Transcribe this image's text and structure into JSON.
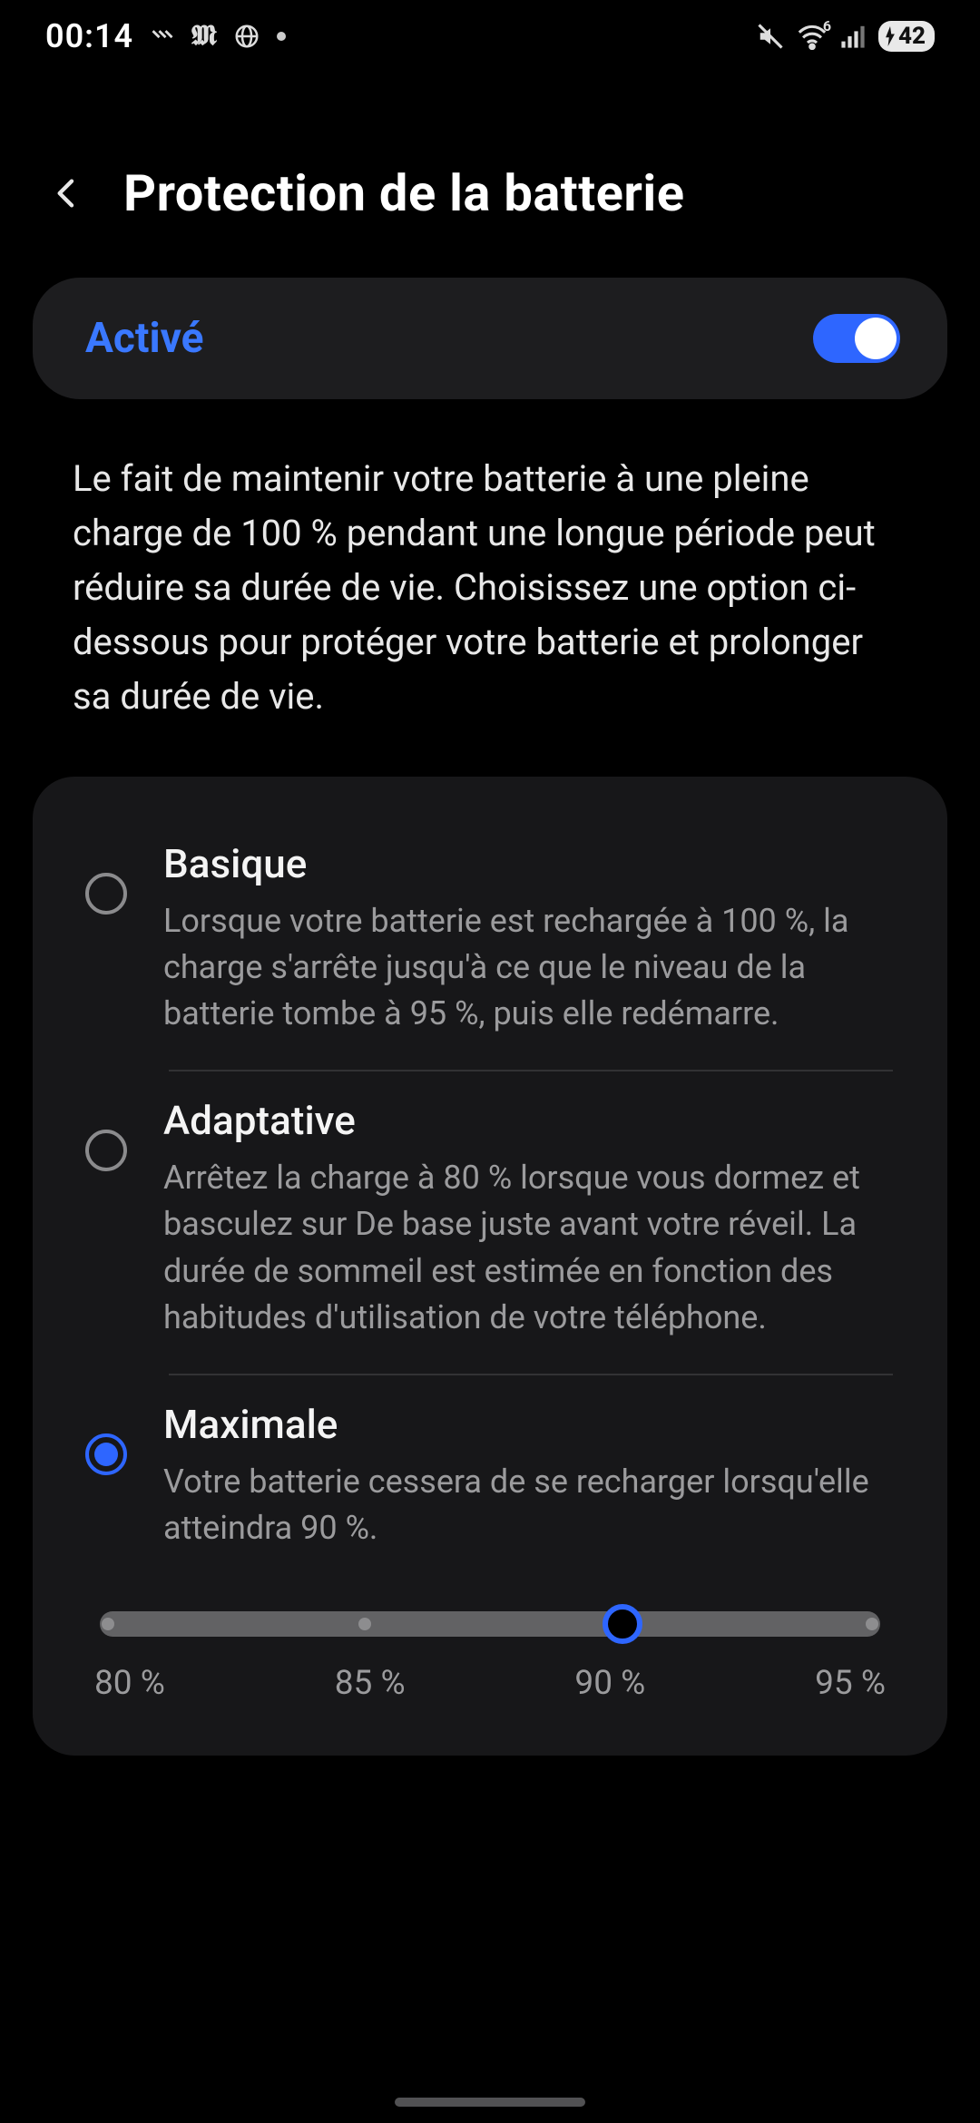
{
  "status": {
    "clock": "00:14",
    "icons_left": [
      "bars-icon",
      "m-logo-icon",
      "globe-icon"
    ],
    "battery_level": "42",
    "wifi_label": "6"
  },
  "header": {
    "title": "Protection de la batterie"
  },
  "enabled": {
    "label": "Activé",
    "on": true
  },
  "description": "Le fait de maintenir votre batterie à une pleine charge de 100 % pendant une longue période peut réduire sa durée de vie. Choisissez une option ci-dessous pour protéger votre batterie et prolonger sa durée de vie.",
  "options": [
    {
      "id": "basic",
      "title": "Basique",
      "desc": "Lorsque votre batterie est rechargée à 100 %, la charge s'arrête jusqu'à ce que le niveau de la batterie tombe à 95 %, puis elle redémarre.",
      "selected": false
    },
    {
      "id": "adaptive",
      "title": "Adaptative",
      "desc": "Arrêtez la charge à 80 % lorsque vous dormez et basculez sur De base juste avant votre réveil. La durée de sommeil est estimée en fonction des habitudes d'utilisation de votre téléphone.",
      "selected": false
    },
    {
      "id": "max",
      "title": "Maximale",
      "desc": "Votre batterie cessera de se recharger lorsqu'elle atteindra 90 %.",
      "selected": true
    }
  ],
  "slider": {
    "stops": [
      "80 %",
      "85 %",
      "90 %",
      "95 %"
    ],
    "selected_index": 2
  }
}
